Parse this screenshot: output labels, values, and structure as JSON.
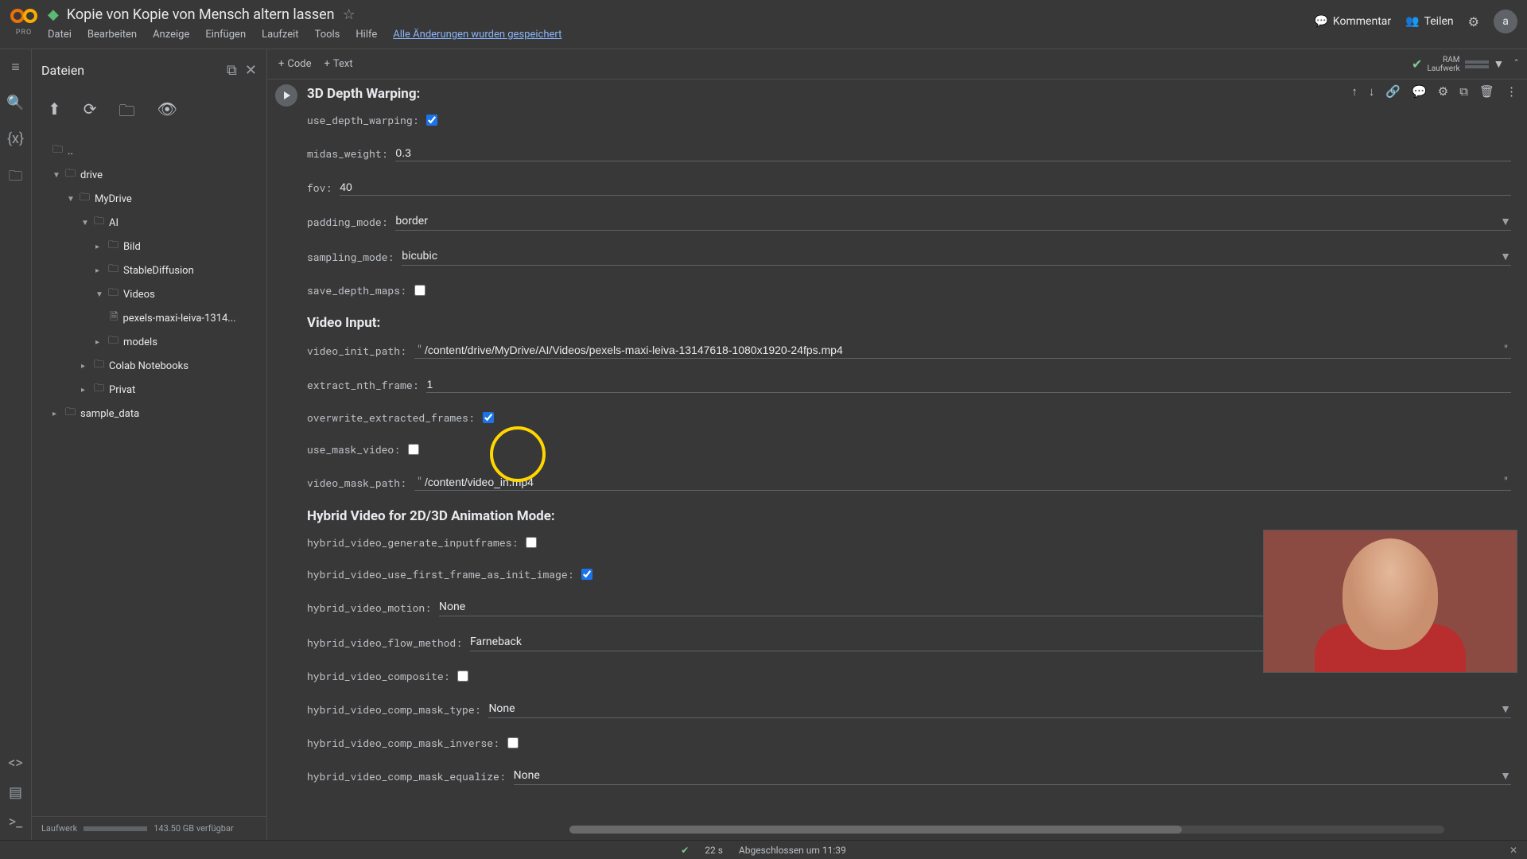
{
  "header": {
    "pro": "PRO",
    "title": "Kopie von Kopie von Mensch altern lassen",
    "menu": [
      "Datei",
      "Bearbeiten",
      "Anzeige",
      "Einfügen",
      "Laufzeit",
      "Tools",
      "Hilfe"
    ],
    "save_status": "Alle Änderungen wurden gespeichert",
    "comment": "Kommentar",
    "share": "Teilen",
    "avatar": "a"
  },
  "toolbar": {
    "code": "Code",
    "text": "Text",
    "ram_label": "RAM",
    "disk_label": "Laufwerk"
  },
  "files": {
    "title": "Dateien",
    "nodes": {
      "dotdot": "..",
      "drive": "drive",
      "mydrive": "MyDrive",
      "ai": "AI",
      "bild": "Bild",
      "sd": "StableDiffusion",
      "videos": "Videos",
      "video_file": "pexels-maxi-leiva-1314...",
      "models": "models",
      "colab": "Colab Notebooks",
      "privat": "Privat",
      "sample": "sample_data"
    },
    "footer_label": "Laufwerk",
    "footer_space": "143.50 GB verfügbar"
  },
  "cell": {
    "sections": {
      "depth": "3D Depth Warping:",
      "video_input": "Video Input:",
      "hybrid": "Hybrid Video for 2D/3D Animation Mode:"
    },
    "fields": {
      "use_depth_warping": {
        "label": "use_depth_warping:",
        "checked": true
      },
      "midas_weight": {
        "label": "midas_weight:",
        "value": "0.3"
      },
      "fov": {
        "label": "fov:",
        "value": "40"
      },
      "padding_mode": {
        "label": "padding_mode:",
        "value": "border"
      },
      "sampling_mode": {
        "label": "sampling_mode:",
        "value": "bicubic"
      },
      "save_depth_maps": {
        "label": "save_depth_maps:",
        "checked": false
      },
      "video_init_path": {
        "label": "video_init_path:",
        "value": "/content/drive/MyDrive/AI/Videos/pexels-maxi-leiva-13147618-1080x1920-24fps.mp4"
      },
      "extract_nth_frame": {
        "label": "extract_nth_frame:",
        "value": "1"
      },
      "overwrite_extracted_frames": {
        "label": "overwrite_extracted_frames:",
        "checked": true
      },
      "use_mask_video": {
        "label": "use_mask_video:",
        "checked": false
      },
      "video_mask_path": {
        "label": "video_mask_path:",
        "value": "/content/video_in.mp4"
      },
      "hybrid_generate_inputframes": {
        "label": "hybrid_video_generate_inputframes:",
        "checked": false
      },
      "hybrid_first_frame_init": {
        "label": "hybrid_video_use_first_frame_as_init_image:",
        "checked": true
      },
      "hybrid_motion": {
        "label": "hybrid_video_motion:",
        "value": "None"
      },
      "hybrid_flow_method": {
        "label": "hybrid_video_flow_method:",
        "value": "Farneback"
      },
      "hybrid_composite": {
        "label": "hybrid_video_composite:",
        "checked": false
      },
      "hybrid_comp_mask_type": {
        "label": "hybrid_video_comp_mask_type:",
        "value": "None"
      },
      "hybrid_comp_mask_inverse": {
        "label": "hybrid_video_comp_mask_inverse:",
        "checked": false
      },
      "hybrid_comp_mask_equalize": {
        "label": "hybrid_video_comp_mask_equalize:",
        "value": "None"
      }
    }
  },
  "status": {
    "time": "22 s",
    "completed": "Abgeschlossen um 11:39"
  }
}
